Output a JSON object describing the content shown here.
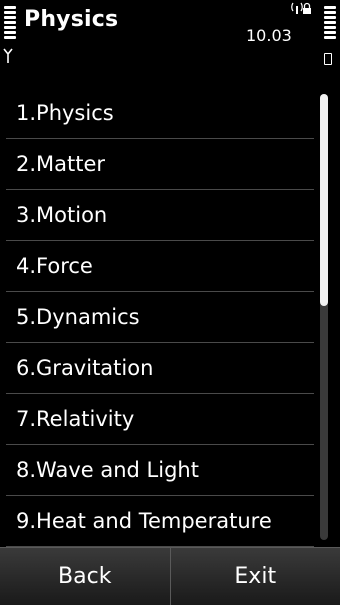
{
  "status": {
    "title": "Physics",
    "clock": "10.03",
    "net_icon": "wifi-lock-icon"
  },
  "list": {
    "items": [
      {
        "label": "1.Physics"
      },
      {
        "label": "2.Matter"
      },
      {
        "label": "3.Motion"
      },
      {
        "label": "4.Force"
      },
      {
        "label": "5.Dynamics"
      },
      {
        "label": "6.Gravitation"
      },
      {
        "label": "7.Relativity"
      },
      {
        "label": "8.Wave and Light"
      },
      {
        "label": "9.Heat and Temperature"
      }
    ]
  },
  "softkeys": {
    "left_label": "Back",
    "right_label": "Exit"
  },
  "colors": {
    "background": "#000000",
    "text": "#ffffff",
    "separator": "#4a4a4a",
    "softkey_bg": "#2a2a2a"
  }
}
